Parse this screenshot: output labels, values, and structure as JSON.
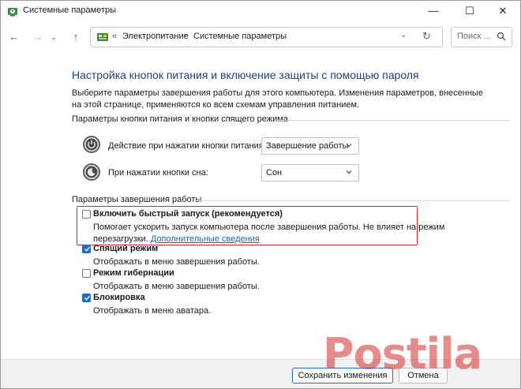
{
  "window": {
    "title": "Системные параметры",
    "controls": {
      "minimize": "—",
      "maximize": "☐",
      "close": "✕"
    }
  },
  "nav": {
    "back": "←",
    "forward": "→",
    "recent": "⌄",
    "up": "↑"
  },
  "address": {
    "prefix": "«",
    "breadcrumbs": [
      "Электропитание",
      "Системные параметры"
    ],
    "separator": "›",
    "dropdown": "⌄",
    "refresh": "↻"
  },
  "search": {
    "placeholder": "Поиск ..."
  },
  "main": {
    "heading": "Настройка кнопок питания и включение защиты с помощью пароля",
    "intro": "Выберите параметры завершения работы для этого компьютера. Изменения параметров, внесенные на этой странице, применяются ко всем схемам управления питанием.",
    "buttons_group": {
      "title": "Параметры кнопки питания и кнопки спящего режима",
      "items": [
        {
          "label": "Действие при нажатии кнопки питания:",
          "value": "Завершение работы",
          "icon": "power-button-icon"
        },
        {
          "label": "При нажатии кнопки сна:",
          "value": "Сон",
          "icon": "sleep-button-icon"
        }
      ]
    },
    "shutdown_group": {
      "title": "Параметры завершения работы",
      "options": [
        {
          "title": "Включить быстрый запуск (рекомендуется)",
          "desc_line1": "Помогает ускорить запуск компьютера после завершения работы. Не влияет на режим",
          "desc_line2": "перезагрузки.",
          "link": "Дополнительные сведения",
          "checked": false,
          "highlighted": true
        },
        {
          "title": "Спящий режим",
          "desc": "Отображать в меню завершения работы.",
          "checked": true
        },
        {
          "title": "Режим гибернации",
          "desc": "Отображать в меню завершения работы.",
          "checked": false
        },
        {
          "title": "Блокировка",
          "desc": "Отображать в меню аватара.",
          "checked": true
        }
      ]
    }
  },
  "footer": {
    "save": "Сохранить изменения",
    "cancel": "Отмена"
  },
  "watermark": {
    "text": "Postila"
  },
  "colors": {
    "heading": "#1e3f8a",
    "accent": "#1f6dc6",
    "link": "#1e62c6",
    "highlight_border": "#d9262f"
  }
}
